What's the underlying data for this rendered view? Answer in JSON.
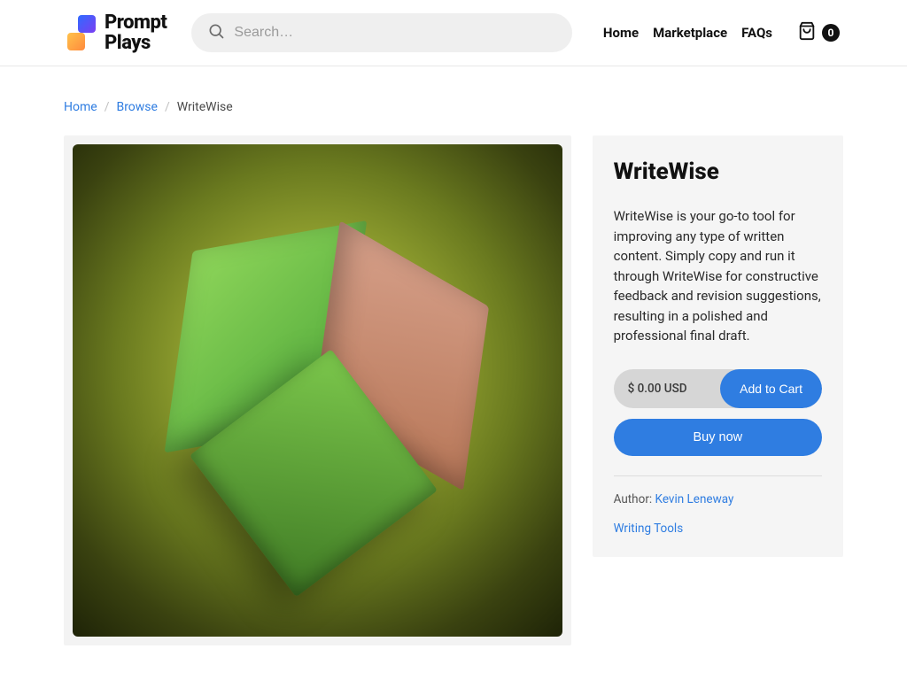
{
  "header": {
    "logo_line1": "Prompt",
    "logo_line2": "Plays",
    "search_placeholder": "Search…",
    "nav": {
      "home": "Home",
      "marketplace": "Marketplace",
      "faqs": "FAQs"
    },
    "cart_count": "0"
  },
  "breadcrumb": {
    "home": "Home",
    "browse": "Browse",
    "current": "WriteWise"
  },
  "product": {
    "title": "WriteWise",
    "description": "WriteWise is your go-to tool for improving any type of written content. Simply copy and run it through WriteWise for constructive feedback and revision suggestions, resulting in a polished and professional final draft.",
    "price": "$ 0.00 USD",
    "add_to_cart": "Add to Cart",
    "buy_now": "Buy now",
    "author_label": "Author:",
    "author_name": "Kevin Leneway",
    "category": "Writing Tools"
  }
}
